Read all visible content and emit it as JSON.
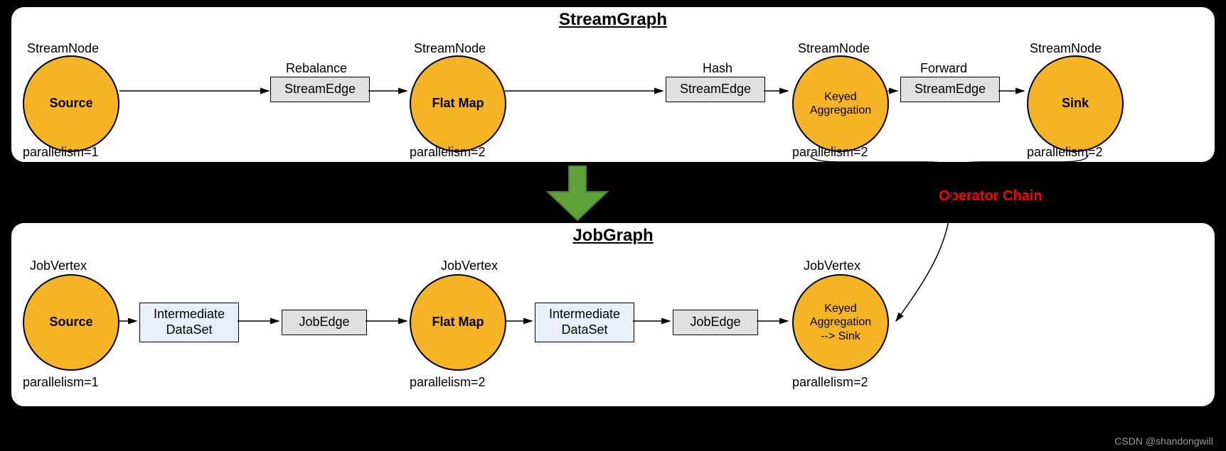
{
  "streamGraph": {
    "title": "StreamGraph",
    "nodes": [
      {
        "typeLabel": "StreamNode",
        "name": "Source",
        "parallelism": "parallelism=1"
      },
      {
        "typeLabel": "StreamNode",
        "name": "Flat Map",
        "parallelism": "parallelism=2"
      },
      {
        "typeLabel": "StreamNode",
        "name": "Keyed\nAggregation",
        "parallelism": "parallelism=2"
      },
      {
        "typeLabel": "StreamNode",
        "name": "Sink",
        "parallelism": "parallelism=2"
      }
    ],
    "edges": [
      {
        "partitioner": "Rebalance",
        "label": "StreamEdge"
      },
      {
        "partitioner": "Hash",
        "label": "StreamEdge"
      },
      {
        "partitioner": "Forward",
        "label": "StreamEdge"
      }
    ]
  },
  "jobGraph": {
    "title": "JobGraph",
    "vertices": [
      {
        "typeLabel": "JobVertex",
        "name": "Source",
        "parallelism": "parallelism=1"
      },
      {
        "typeLabel": "JobVertex",
        "name": "Flat Map",
        "parallelism": "parallelism=2"
      },
      {
        "typeLabel": "JobVertex",
        "name": "Keyed\nAggregation\n--> Sink",
        "parallelism": "parallelism=2"
      }
    ],
    "dataSets": [
      {
        "label": "Intermediate\nDataSet"
      },
      {
        "label": "Intermediate\nDataSet"
      }
    ],
    "edges": [
      {
        "label": "JobEdge"
      },
      {
        "label": "JobEdge"
      }
    ]
  },
  "operatorChainLabel": "Operator Chain",
  "watermark": "CSDN @shandongwill"
}
